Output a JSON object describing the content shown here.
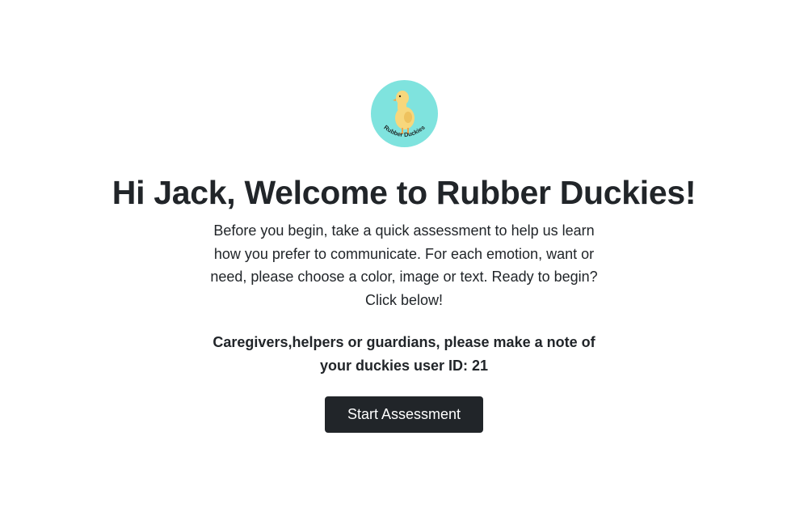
{
  "logo": {
    "text": "Rubber Duckies",
    "background_color": "#7fe3de",
    "duck_color": "#f7d77c"
  },
  "welcome": {
    "heading": "Hi Jack, Welcome to Rubber Duckies!",
    "intro": "Before you begin, take a quick assessment to help us learn how you prefer to communicate. For each emotion, want or need, please choose a color, image or text. Ready to begin? Click below!",
    "caregiver_note": "Caregivers,helpers or guardians, please make a note of your duckies user ID: 21"
  },
  "actions": {
    "start_label": "Start Assessment"
  },
  "colors": {
    "button_bg": "#212529",
    "button_text": "#ffffff",
    "text": "#212529"
  }
}
